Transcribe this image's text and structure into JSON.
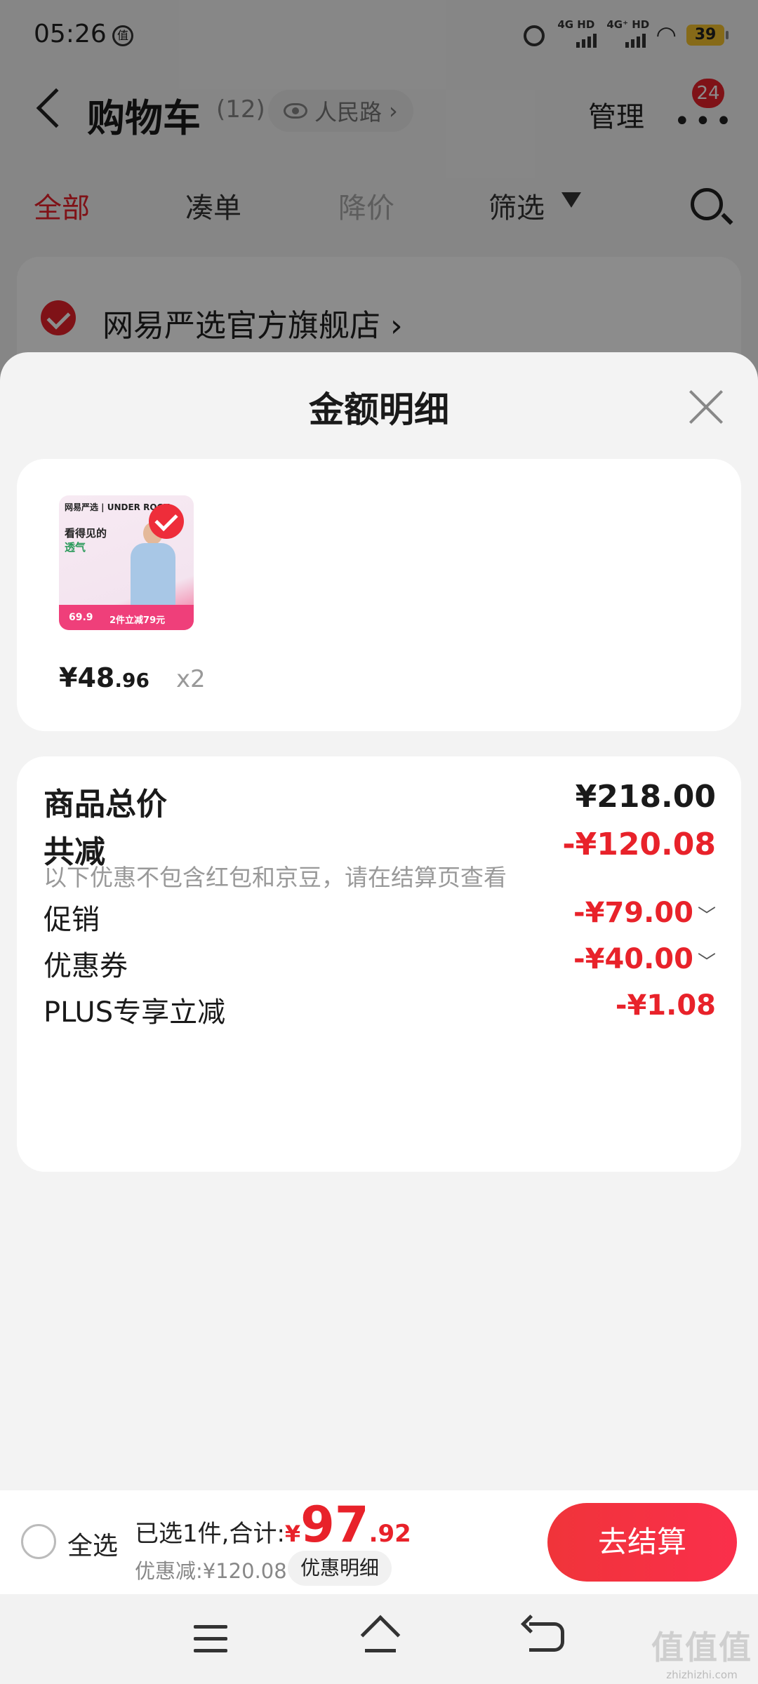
{
  "status_bar": {
    "time": "05:26",
    "net1": "4G HD",
    "net2": "4G⁺ HD",
    "battery": "39"
  },
  "header": {
    "title": "购物车",
    "count": "(12)",
    "location": "人民路",
    "location_chevron": "›",
    "manage_label": "管理",
    "more_dots": "•••",
    "badge": "24"
  },
  "tabs": [
    "全部",
    "凑单",
    "降价",
    "筛选"
  ],
  "store": {
    "name": "网易严选官方旗舰店",
    "chevron": "›"
  },
  "sheet": {
    "title": "金额明细",
    "product": {
      "image_logo": "网易严选 | UNDER ROCK",
      "image_headline_1": "看得见的",
      "image_headline_2": "透气",
      "image_price": "69.9",
      "image_promo": "2件立减79元",
      "price_int": "¥48",
      "price_dec": ".96",
      "qty": "x2"
    },
    "details": {
      "total_label": "商品总价",
      "total_value": "¥218.00",
      "discount_label": "共减",
      "discount_value": "-¥120.08",
      "note": "以下优惠不包含红包和京豆，请在结算页查看",
      "promo_label": "促销",
      "promo_value": "-¥79.00",
      "coupon_label": "优惠券",
      "coupon_value": "-¥40.00",
      "plus_label": "PLUS专享立减",
      "plus_value": "-¥1.08",
      "expand_chevron": "﹀"
    }
  },
  "checkout": {
    "select_all": "全选",
    "selected_text": "已选1件,合计:",
    "yen": "¥",
    "total_int": "97",
    "total_dec": ".92",
    "saved": "优惠减:¥120.08",
    "detail_button": "优惠明细",
    "pay_button": "去结算"
  },
  "watermark": {
    "glyphs": "值值值",
    "url": "zhizhizhi.com"
  },
  "colors": {
    "accent": "#e8222a",
    "sheet_bg": "#f3f3f3",
    "card_bg": "#ffffff"
  }
}
